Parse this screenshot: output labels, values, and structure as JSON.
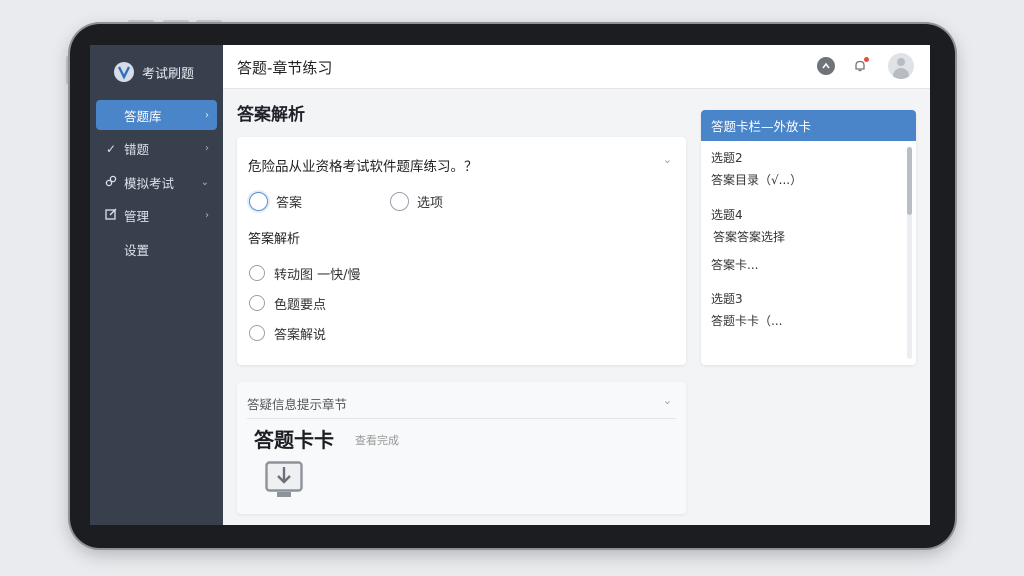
{
  "app": {
    "name": "考试刷题"
  },
  "sidebar": {
    "items": [
      {
        "label": "答题库",
        "icon": "grid-icon",
        "active": true
      },
      {
        "label": "错题",
        "icon": "check-icon",
        "active": false
      },
      {
        "label": "模拟考试",
        "icon": "link-icon",
        "active": false
      },
      {
        "label": "管理",
        "icon": "edit-icon",
        "active": false
      },
      {
        "label": "设置",
        "icon": "",
        "active": false
      }
    ]
  },
  "header": {
    "breadcrumb": "答题-章节练习"
  },
  "main": {
    "section_title": "答案解析",
    "question": {
      "text": "危险品从业资格考试软件题库练习。？",
      "top_options": [
        {
          "label": "答案",
          "selected": true
        },
        {
          "label": "选项",
          "selected": false
        }
      ],
      "sub_label": "答案解析",
      "options": [
        {
          "label": "转动图 一快/慢"
        },
        {
          "label": "色题要点"
        },
        {
          "label": "答案解说"
        }
      ]
    },
    "card2": {
      "header": "答疑信息提示章节",
      "big_text": "答题卡卡",
      "small_text": "查看完成"
    }
  },
  "answer_card": {
    "title": "答题卡栏—外放卡",
    "items": [
      "选题2",
      "答案目录（√...）",
      "选题4",
      "答案答案选择",
      "答案卡...",
      "选题3",
      "答题卡卡（..."
    ]
  },
  "colors": {
    "accent": "#4a84c9",
    "sidebar_bg": "#38404d",
    "notification_dot": "#e74c3c"
  }
}
